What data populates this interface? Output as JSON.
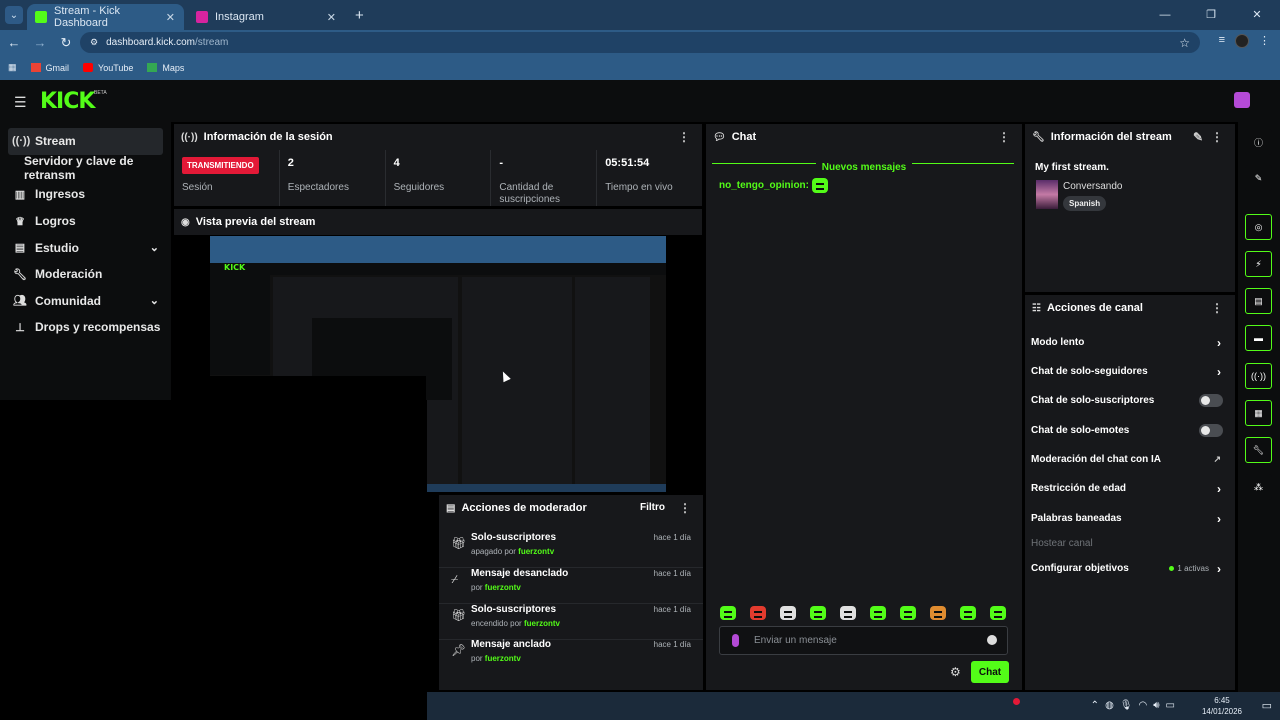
{
  "browser": {
    "tabs": [
      {
        "title": "Stream - Kick Dashboard",
        "active": true
      },
      {
        "title": "Instagram",
        "active": false
      }
    ],
    "url_host": "dashboard.kick.com",
    "url_path": "/stream",
    "bookmarks": [
      "Gmail",
      "YouTube",
      "Maps"
    ]
  },
  "app": {
    "logo": "KICK",
    "logo_badge": "BETA"
  },
  "sidebar": {
    "items": [
      {
        "label": "Stream",
        "icon": "broadcast-icon"
      },
      {
        "label": "Servidor y clave de retransm",
        "icon": ""
      },
      {
        "label": "Ingresos",
        "icon": "chart-icon"
      },
      {
        "label": "Logros",
        "icon": "trophy-icon"
      },
      {
        "label": "Estudio",
        "icon": "studio-icon"
      },
      {
        "label": "Moderación",
        "icon": "wrench-icon"
      },
      {
        "label": "Comunidad",
        "icon": "people-icon"
      },
      {
        "label": "Drops y recompensas",
        "icon": "drops-icon"
      }
    ]
  },
  "session": {
    "title": "Información de la sesión",
    "status_badge": "TRANSMITIENDO",
    "stats": [
      {
        "value": "",
        "label": "Sesión"
      },
      {
        "value": "2",
        "label": "Espectadores"
      },
      {
        "value": "4",
        "label": "Seguidores"
      },
      {
        "value": "-",
        "label": "Cantidad de suscripciones"
      },
      {
        "value": "05:51:54",
        "label": "Tiempo en vivo"
      }
    ]
  },
  "preview": {
    "title": "Vista previa del stream"
  },
  "chat": {
    "title": "Chat",
    "new_messages": "Nuevos mensajes",
    "message_user": "no_tengo_opinion:",
    "input_placeholder": "Enviar un mensaje",
    "send_label": "Chat"
  },
  "stream_info": {
    "title": "Información del stream",
    "stream_title": "My first stream.",
    "category": "Conversando",
    "language": "Spanish"
  },
  "channel_actions": {
    "title": "Acciones de canal",
    "items": [
      {
        "label": "Modo lento",
        "control": "chevron"
      },
      {
        "label": "Chat de solo-seguidores",
        "control": "chevron"
      },
      {
        "label": "Chat de solo-suscriptores",
        "control": "toggle",
        "on": false
      },
      {
        "label": "Chat de solo-emotes",
        "control": "toggle",
        "on": false
      },
      {
        "label": "Moderación del chat con IA",
        "control": "external"
      },
      {
        "label": "Restricción de edad",
        "control": "chevron"
      },
      {
        "label": "Palabras baneadas",
        "control": "chevron"
      },
      {
        "label": "Hostear canal",
        "control": "disabled"
      },
      {
        "label": "Configurar objetivos",
        "control": "chevron",
        "extra": "1 activas"
      }
    ]
  },
  "mod_actions": {
    "title": "Acciones de moderador",
    "filter_label": "Filtro",
    "rows": [
      {
        "title": "Solo-suscriptores",
        "prefix": "apagado por",
        "user": "fuerzontv",
        "when": "hace 1 día",
        "icon": "gift-icon"
      },
      {
        "title": "Mensaje desanclado",
        "prefix": "por",
        "user": "fuerzontv",
        "when": "hace 1 día",
        "icon": "unpin-icon"
      },
      {
        "title": "Solo-suscriptores",
        "prefix": "encendido por",
        "user": "fuerzontv",
        "when": "hace 1 día",
        "icon": "gift-icon"
      },
      {
        "title": "Mensaje anclado",
        "prefix": "por",
        "user": "fuerzontv",
        "when": "hace 1 día",
        "icon": "pin-icon"
      }
    ]
  },
  "taskbar": {
    "time": "6:45",
    "date": "14/01/2026"
  },
  "colors": {
    "accent": "#53fc18",
    "live": "#e31937",
    "panel": "#17181b",
    "browser": "#2d5b86"
  }
}
